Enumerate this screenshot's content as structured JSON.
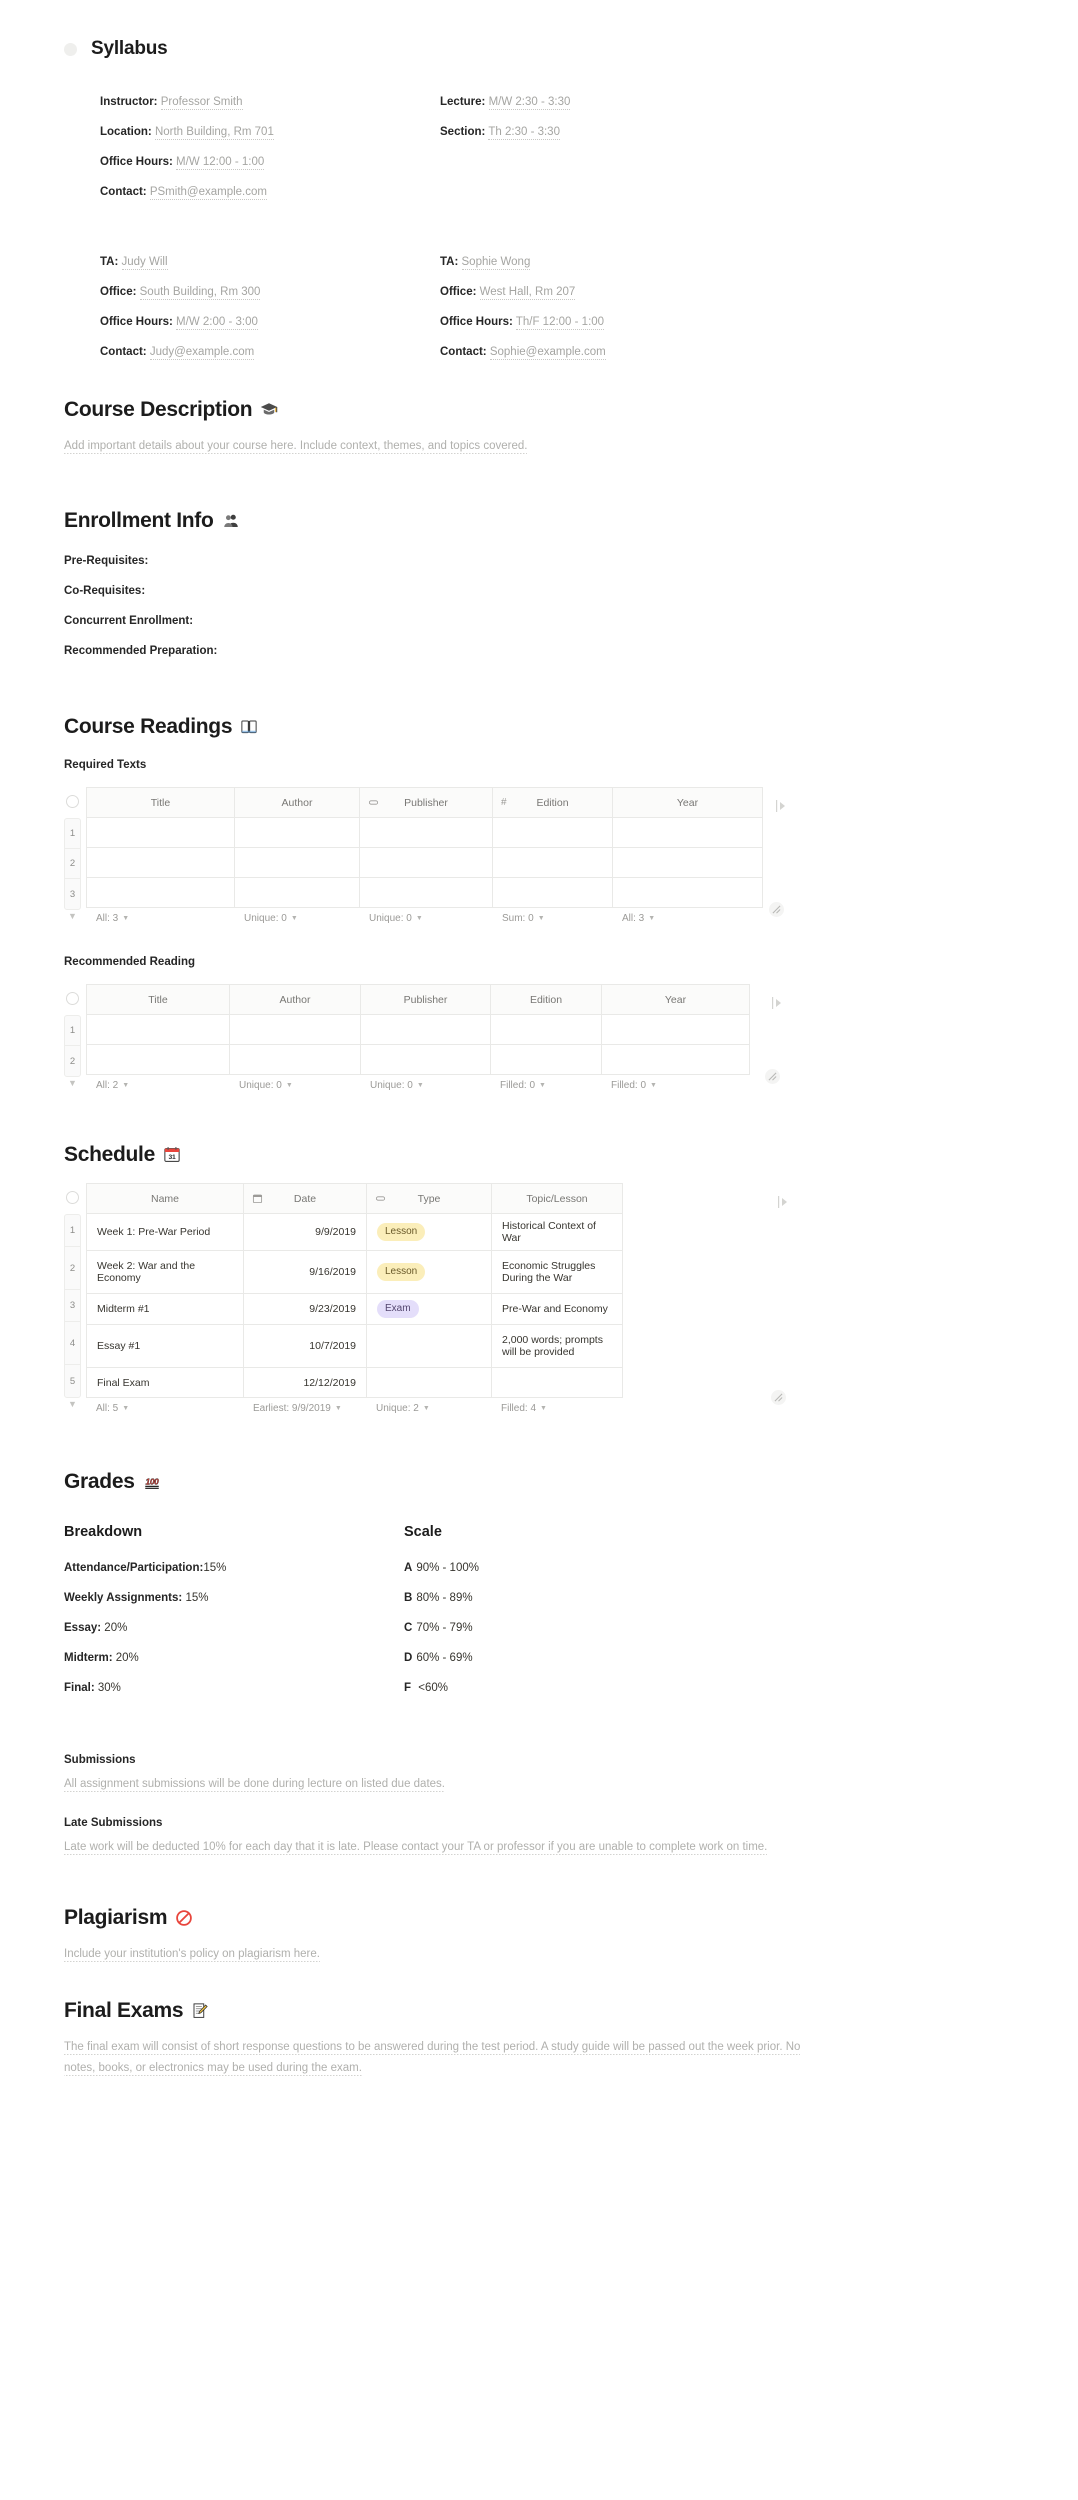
{
  "page": {
    "title": "Syllabus"
  },
  "info": {
    "left": [
      {
        "label": "Instructor:",
        "value": "Professor Smith"
      },
      {
        "label": "Location:",
        "value": "North Building, Rm 701"
      },
      {
        "label": "Office Hours:",
        "value": "M/W 12:00 - 1:00"
      },
      {
        "label": "Contact:",
        "value": "PSmith@example.com"
      }
    ],
    "right": [
      {
        "label": "Lecture:",
        "value": "M/W 2:30 - 3:30"
      },
      {
        "label": "Section:",
        "value": "Th 2:30 - 3:30"
      }
    ],
    "ta_left": [
      {
        "label": "TA:",
        "value": "Judy Will"
      },
      {
        "label": "Office:",
        "value": "South Building, Rm 300"
      },
      {
        "label": "Office Hours:",
        "value": "M/W 2:00 - 3:00"
      },
      {
        "label": "Contact:",
        "value": "Judy@example.com"
      }
    ],
    "ta_right": [
      {
        "label": "TA:",
        "value": "Sophie Wong"
      },
      {
        "label": "Office:",
        "value": "West Hall, Rm 207"
      },
      {
        "label": "Office Hours:",
        "value": "Th/F 12:00 - 1:00"
      },
      {
        "label": "Contact:",
        "value": "Sophie@example.com"
      }
    ]
  },
  "course_description": {
    "heading": "Course Description",
    "emoji": "graduation-cap",
    "body": "Add important details about your course here. Include context, themes, and topics covered."
  },
  "enrollment": {
    "heading": "Enrollment Info",
    "emoji": "busts-in-silhouette",
    "items": [
      "Pre-Requisites:",
      "Co-Requisites:",
      "Concurrent Enrollment:",
      "Recommended Preparation:"
    ]
  },
  "readings": {
    "heading": "Course Readings",
    "emoji": "open-book",
    "required": {
      "label": "Required Texts",
      "columns": [
        "Title",
        "Author",
        "Publisher",
        "Edition",
        "Year"
      ],
      "column_icons": [
        "",
        "",
        "select-icon",
        "number-icon",
        ""
      ],
      "rows": [
        [
          "",
          "",
          "",
          "",
          ""
        ],
        [
          "",
          "",
          "",
          "",
          ""
        ],
        [
          "",
          "",
          "",
          "",
          ""
        ]
      ],
      "row_numbers": [
        "1",
        "2",
        "3"
      ],
      "aggregations": [
        "All: 3",
        "Unique: 0",
        "Unique: 0",
        "Sum: 0",
        "All: 3"
      ]
    },
    "recommended": {
      "label": "Recommended Reading",
      "columns": [
        "Title",
        "Author",
        "Publisher",
        "Edition",
        "Year"
      ],
      "rows": [
        [
          "",
          "",
          "",
          "",
          ""
        ],
        [
          "",
          "",
          "",
          "",
          ""
        ]
      ],
      "row_numbers": [
        "1",
        "2"
      ],
      "aggregations": [
        "All: 2",
        "Unique: 0",
        "Unique: 0",
        "Filled: 0",
        "Filled: 0"
      ]
    }
  },
  "schedule": {
    "heading": "Schedule",
    "emoji": "calendar",
    "columns": [
      "Name",
      "Date",
      "Type",
      "Topic/Lesson"
    ],
    "column_icons": [
      "",
      "date-icon",
      "select-icon",
      ""
    ],
    "row_numbers": [
      "1",
      "2",
      "3",
      "4",
      "5"
    ],
    "rows": [
      {
        "name": "Week 1: Pre-War Period",
        "date": "9/9/2019",
        "type": "Lesson",
        "type_color": "#fbeeba",
        "topic": "Historical Context of War"
      },
      {
        "name": "Week 2: War and the Economy",
        "date": "9/16/2019",
        "type": "Lesson",
        "type_color": "#fbeeba",
        "topic": "Economic Struggles During the War"
      },
      {
        "name": "Midterm #1",
        "date": "9/23/2019",
        "type": "Exam",
        "type_color": "#e4defa",
        "topic": "Pre-War and Economy"
      },
      {
        "name": "Essay #1",
        "date": "10/7/2019",
        "type": "",
        "type_color": "",
        "topic": "2,000 words; prompts will be provided"
      },
      {
        "name": "Final Exam",
        "date": "12/12/2019",
        "type": "",
        "type_color": "",
        "topic": ""
      }
    ],
    "aggregations": [
      "All: 5",
      "Earliest: 9/9/2019",
      "Unique: 2",
      "Filled: 4"
    ]
  },
  "grades": {
    "heading": "Grades",
    "emoji": "hundred-points",
    "breakdown_heading": "Breakdown",
    "breakdown": [
      {
        "label": "Attendance/Participation:",
        "value": "15%"
      },
      {
        "label": "Weekly Assignments:",
        "value": "15%"
      },
      {
        "label": "Essay:",
        "value": "20%"
      },
      {
        "label": "Midterm:",
        "value": "20%"
      },
      {
        "label": "Final:",
        "value": "30%"
      }
    ],
    "scale_heading": "Scale",
    "scale": [
      {
        "grade": "A",
        "range": "90% - 100%"
      },
      {
        "grade": "B",
        "range": "80% - 89%"
      },
      {
        "grade": "C",
        "range": "70% - 79%"
      },
      {
        "grade": "D",
        "range": "60% - 69%"
      },
      {
        "grade": "F",
        "range": "<60%"
      }
    ]
  },
  "submissions": {
    "heading": "Submissions",
    "body": "All assignment submissions will be done during lecture on listed due dates.",
    "late_heading": "Late Submissions",
    "late_body": "Late work will be deducted 10% for each day that it is late. Please contact your TA or professor if you are unable to complete work on time."
  },
  "plagiarism": {
    "heading": "Plagiarism",
    "emoji": "prohibited",
    "body": "Include your institution's policy on plagiarism here."
  },
  "final_exams": {
    "heading": "Final Exams",
    "emoji": "memo",
    "body": "The final exam will consist of short response questions to be answered during the test period. A study guide will be passed out the week prior. No notes, books, or electronics may be used during the exam."
  }
}
